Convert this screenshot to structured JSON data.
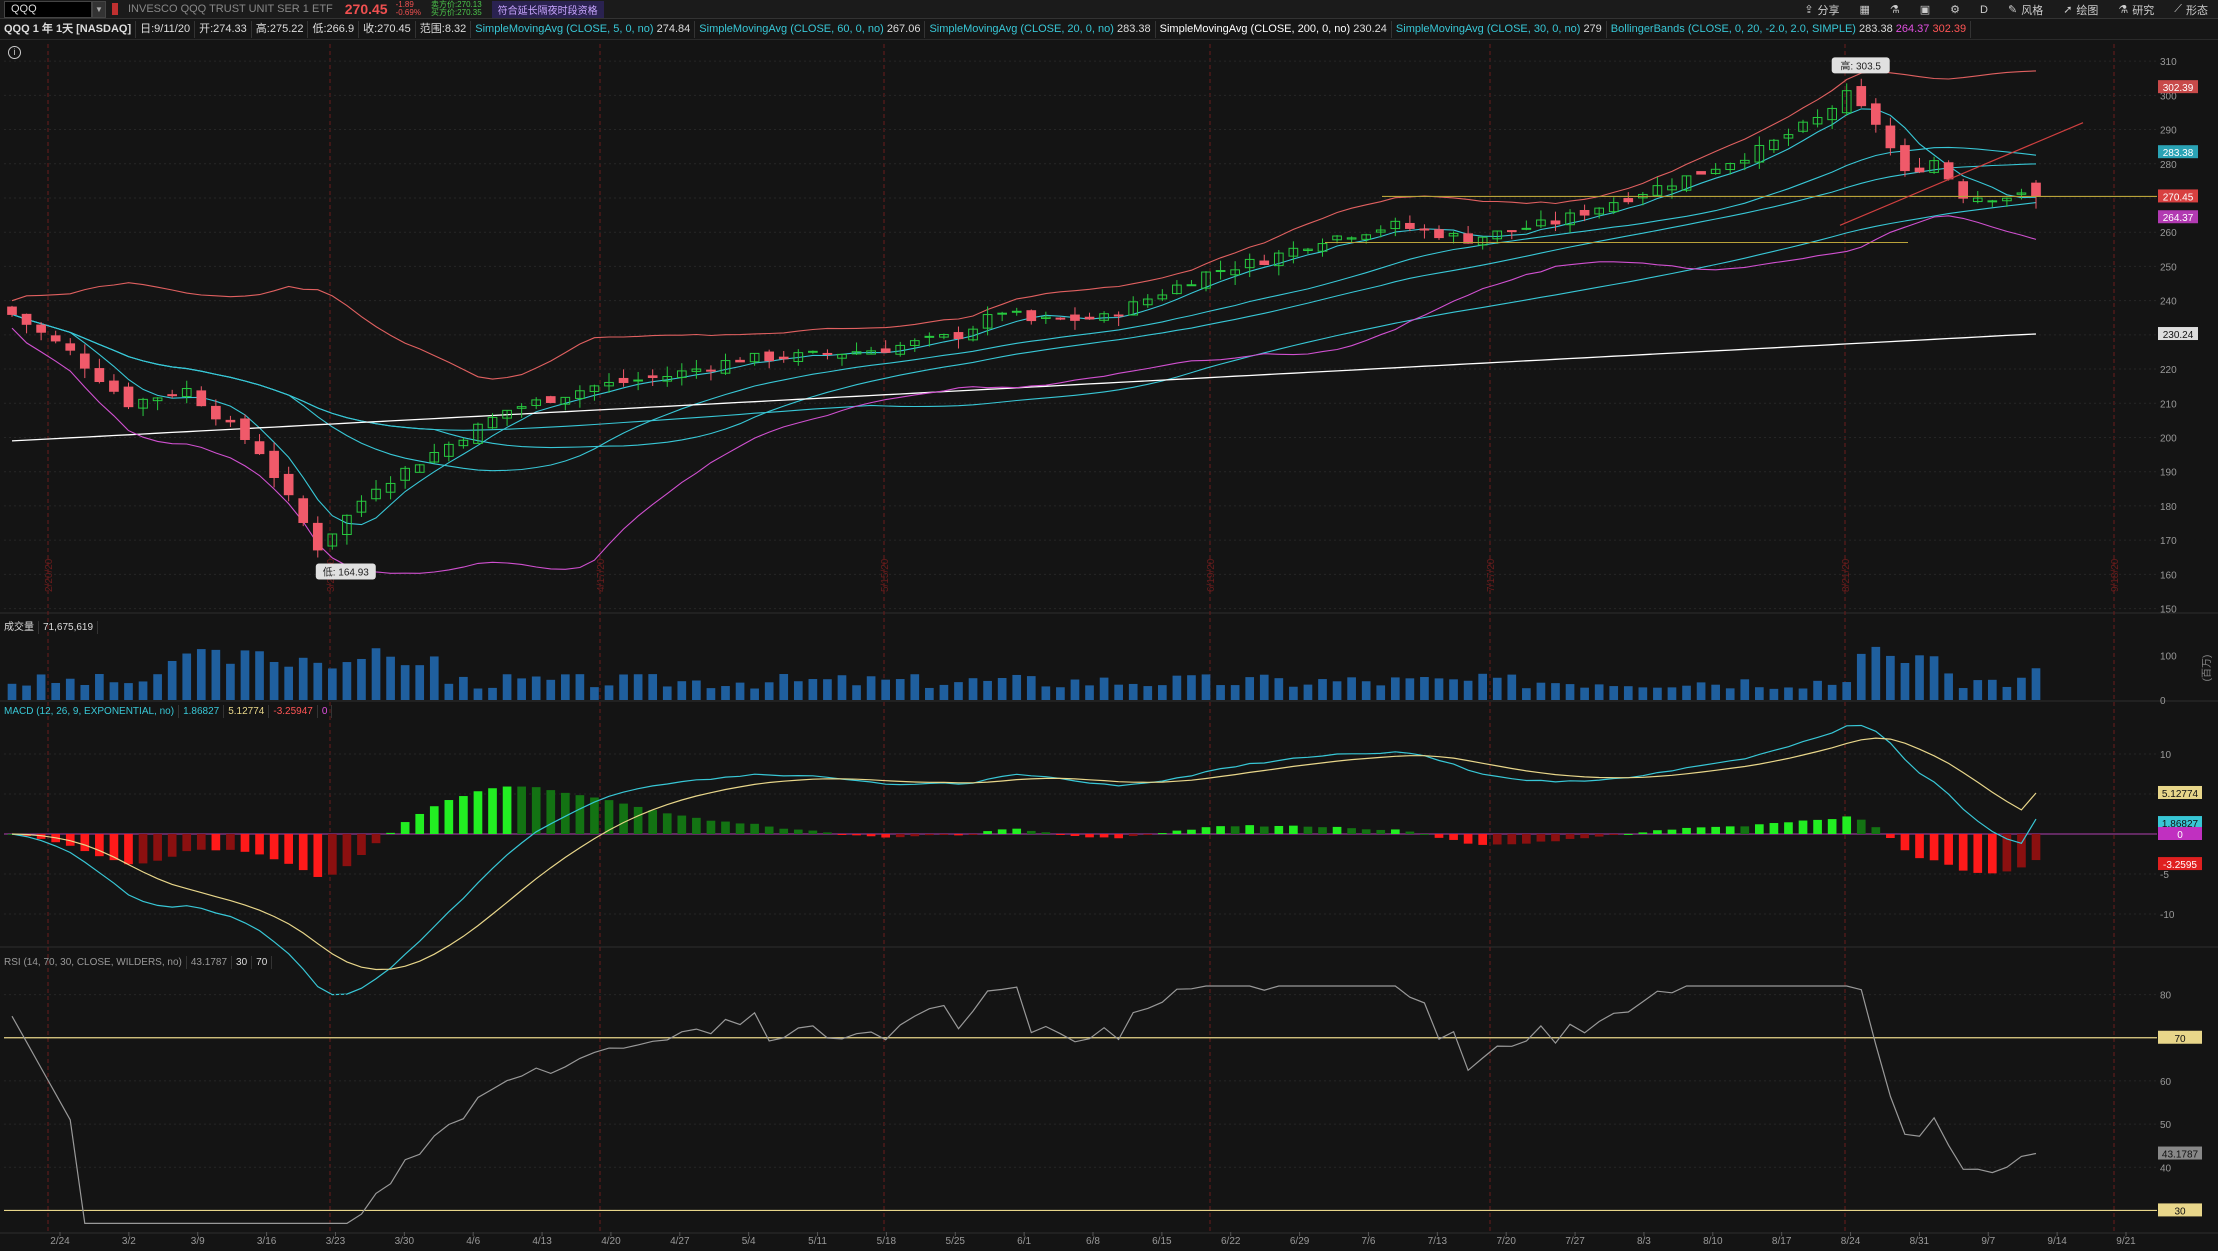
{
  "header": {
    "symbol": "QQQ",
    "description": "INVESCO QQQ TRUST UNIT SER 1 ETF",
    "last": "270.45",
    "change": "-1.89",
    "change_pct": "-0.69%",
    "bid_line": "卖方价:270.13",
    "ask_line": "买方价:270.35",
    "extended_hours": "符合延长隔夜时段资格"
  },
  "toolbar": [
    {
      "icon": "share-icon",
      "label": "分享"
    },
    {
      "icon": "layout-icon",
      "label": ""
    },
    {
      "icon": "flask-icon",
      "label": ""
    },
    {
      "icon": "cube-icon",
      "label": ""
    },
    {
      "icon": "gear-icon",
      "label": ""
    },
    {
      "icon": "",
      "label": "D"
    },
    {
      "icon": "brush-icon",
      "label": "风格"
    },
    {
      "icon": "cursor-icon",
      "label": "绘图"
    },
    {
      "icon": "flask-icon",
      "label": "研究"
    },
    {
      "icon": "pattern-icon",
      "label": "形态"
    }
  ],
  "study_bar": {
    "title": "QQQ 1 年 1天 [NASDAQ]",
    "date": "日:9/11/20",
    "open": "开:274.33",
    "high": "高:275.22",
    "low": "低:266.9",
    "close": "收:270.45",
    "range": "范围:8.32",
    "studies": [
      {
        "name": "SimpleMovingAvg (CLOSE, 5, 0, no)",
        "value": "274.84",
        "color": "#38c7d6"
      },
      {
        "name": "SimpleMovingAvg (CLOSE, 60, 0, no)",
        "value": "267.06",
        "color": "#38c7d6"
      },
      {
        "name": "SimpleMovingAvg (CLOSE, 20, 0, no)",
        "value": "283.38",
        "color": "#38c7d6"
      },
      {
        "name": "SimpleMovingAvg (CLOSE, 200, 0, no)",
        "value": "230.24",
        "color": "#ffffff"
      },
      {
        "name": "SimpleMovingAvg (CLOSE, 30, 0, no)",
        "value": "279",
        "color": "#38c7d6"
      },
      {
        "name": "BollingerBands (CLOSE, 0, 20, -2.0, 2.0, SIMPLE)",
        "value": "283.38",
        "v2": "264.37",
        "v3": "302.39",
        "color": "#38c7d6"
      }
    ]
  },
  "volume_header": {
    "label": "成交量",
    "value": "71,675,619"
  },
  "macd_header": {
    "label": "MACD (12, 26, 9, EXPONENTIAL, no)",
    "value": "1.86827",
    "avg": "5.12774",
    "diff": "-3.25947",
    "zero": "0"
  },
  "rsi_header": {
    "label": "RSI (14, 70, 30, CLOSE, WILDERS, no)",
    "value": "43.1787",
    "os": "30",
    "ob": "70"
  },
  "annotations": {
    "high": "高: 303.5",
    "low": "低: 164.93",
    "volume_unit": "(百万)"
  },
  "price_labels": {
    "bb_upper": "302.39",
    "sma20": "283.38",
    "last": "270.45",
    "bb_lower": "264.37",
    "sma200": "230.24"
  },
  "macd_labels": {
    "avg": "5.12774",
    "value": "1.86827",
    "zero": "0",
    "diff": "-3.2595"
  },
  "rsi_labels": {
    "ob": "70",
    "value": "43.1787",
    "os": "30"
  },
  "colors": {
    "background": "#111111",
    "up": "#27c93f",
    "down": "#f05a6a",
    "sma": "#38c7d6",
    "sma200": "#ffffff",
    "bb_mid": "#e06060",
    "bb_band": "#d050d0",
    "macd": "#38c7d6",
    "macd_avg": "#e8d68a",
    "rsi": "#999999",
    "volume": "#1f5f9e"
  },
  "chart_data": [
    {
      "type": "candlestick",
      "title": "QQQ 1 年 1天 [NASDAQ]",
      "x_ticks": [
        "2/24",
        "3/2",
        "3/9",
        "3/16",
        "3/23",
        "3/30",
        "4/6",
        "4/13",
        "4/20",
        "4/27",
        "5/4",
        "5/11",
        "5/18",
        "5/25",
        "6/1",
        "6/8",
        "6/15",
        "6/22",
        "6/29",
        "7/6",
        "7/13",
        "7/20",
        "7/27",
        "8/3",
        "8/10",
        "8/17",
        "8/24",
        "8/31",
        "9/7",
        "9/14",
        "9/21"
      ],
      "period_markers": [
        "2/20/20",
        "3/20/20",
        "4/17/20",
        "5/15/20",
        "6/19/20",
        "7/17/20",
        "8/21/20",
        "9/18/20"
      ],
      "y_ticks": [
        150,
        160,
        170,
        180,
        190,
        200,
        210,
        220,
        230,
        240,
        250,
        260,
        270,
        280,
        290,
        300,
        310
      ],
      "ylim": [
        149,
        315
      ],
      "close_anchors": [
        [
          0,
          236
        ],
        [
          4,
          225
        ],
        [
          8,
          210
        ],
        [
          12,
          214
        ],
        [
          17,
          196
        ],
        [
          21,
          168
        ],
        [
          25,
          186
        ],
        [
          26,
          188
        ],
        [
          30,
          198
        ],
        [
          34,
          208
        ],
        [
          40,
          215
        ],
        [
          45,
          218
        ],
        [
          50,
          223
        ],
        [
          55,
          224
        ],
        [
          60,
          226
        ],
        [
          65,
          230
        ],
        [
          68,
          237
        ],
        [
          70,
          234
        ],
        [
          75,
          235
        ],
        [
          82,
          248
        ],
        [
          86,
          252
        ],
        [
          90,
          258
        ],
        [
          95,
          262
        ],
        [
          100,
          258
        ],
        [
          106,
          263
        ],
        [
          110,
          269
        ],
        [
          115,
          276
        ],
        [
          120,
          284
        ],
        [
          124,
          293
        ],
        [
          126,
          300
        ],
        [
          128,
          292
        ],
        [
          130,
          277
        ],
        [
          132,
          281
        ],
        [
          134,
          271
        ],
        [
          135,
          270.45
        ]
      ],
      "annotations": {
        "high": 303.5,
        "low": 164.93
      }
    },
    {
      "type": "bar",
      "title": "成交量",
      "value": 71675619,
      "y_ticks": [
        0,
        100
      ],
      "unit": "百万"
    },
    {
      "type": "line",
      "title": "MACD (12, 26, 9, EXPONENTIAL, no)",
      "series": [
        "Value",
        "Avg",
        "Diff"
      ],
      "values": {
        "value": 1.86827,
        "avg": 5.12774,
        "diff": -3.25947
      },
      "y_ticks": [
        -10,
        -5,
        0,
        5,
        10
      ]
    },
    {
      "type": "line",
      "title": "RSI (14, 70, 30, CLOSE, WILDERS, no)",
      "value": 43.1787,
      "levels": [
        30,
        70
      ],
      "y_ticks": [
        30,
        40,
        50,
        60,
        70,
        80
      ]
    }
  ]
}
